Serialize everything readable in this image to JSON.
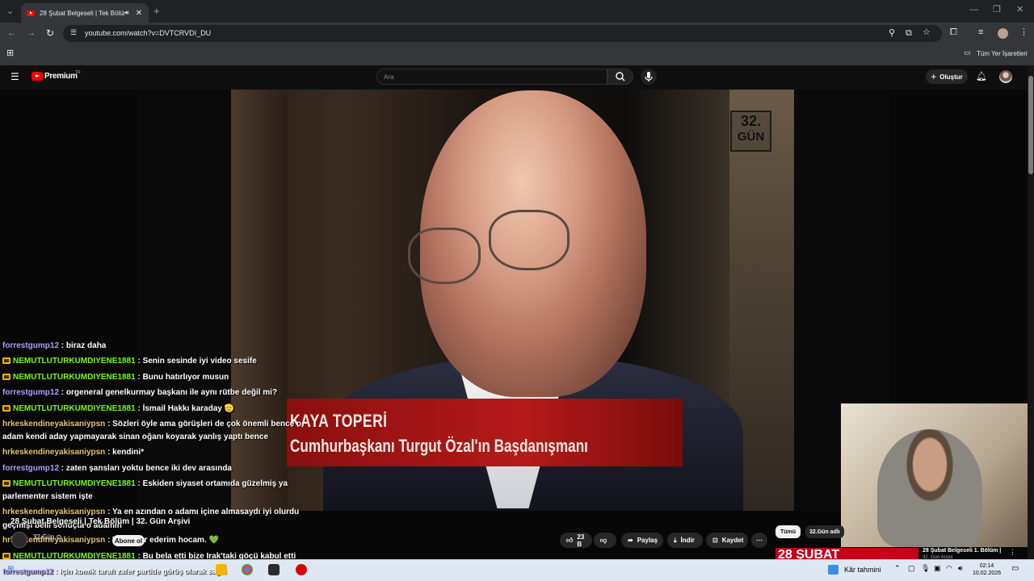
{
  "browser": {
    "tab_title": "28 Şubat Belgeseli | Tek Bölüm",
    "url": "youtube.com/watch?v=DVTCRVDI_DU",
    "bookmarks_label": "Tüm Yer İşaretleri"
  },
  "yt_header": {
    "logo_text": "Premium",
    "logo_region": "TR",
    "search_placeholder": "Ara",
    "create_label": "Oluştur"
  },
  "video": {
    "channel_logo_line1": "32.",
    "channel_logo_line2": "GÜN",
    "lower_third_name": "KAYA TOPERİ",
    "lower_third_title": "Cumhurbaşkanı Turgut Özal'ın Başdanışmanı",
    "title": "28 Şubat Belgeseli | Tek Bölüm | 32. Gün Arşivi",
    "channel": "32.Gün ⊙",
    "subscribe_label": "Abone ol"
  },
  "chat": [
    {
      "user": "forrestgump12",
      "color": "purple",
      "badge": false,
      "text": ": biraz daha"
    },
    {
      "user": "NEMUTLUTURKUMDIYENE1881",
      "color": "green",
      "badge": true,
      "text": ": Senin sesinde iyi video sesife"
    },
    {
      "user": "NEMUTLUTURKUMDIYENE1881",
      "color": "green",
      "badge": true,
      "text": ": Bunu hatırlıyor musun"
    },
    {
      "user": "forrestgump12",
      "color": "purple",
      "badge": false,
      "text": ": orgeneral genelkurmay başkanı ile aynı rütbe değil mi?"
    },
    {
      "user": "NEMUTLUTURKUMDIYENE1881",
      "color": "green",
      "badge": true,
      "text": ": İsmail Hakkı karaday 🫡"
    },
    {
      "user": "hrkeskendineyakisaniypsn",
      "color": "gold",
      "badge": false,
      "text": ": Sözleri öyle ama görüşleri de çok önemli bence o"
    },
    {
      "user": "",
      "color": "",
      "badge": false,
      "text": "adam kendi aday yapmayarak sinan oğanı koyarak yanlış yaptı bence"
    },
    {
      "user": "hrkeskendineyakisaniypsn",
      "color": "gold",
      "badge": false,
      "text": ": kendini*"
    },
    {
      "user": "forrestgump12",
      "color": "purple",
      "badge": false,
      "text": ": zaten şansları yoktu bence iki dev arasında"
    },
    {
      "user": "NEMUTLUTURKUMDIYENE1881",
      "color": "green",
      "badge": true,
      "text": ": Eskiden siyaset ortamıda güzelmiş ya"
    },
    {
      "user": "",
      "color": "",
      "badge": false,
      "text": "parlementer sistem işte"
    },
    {
      "user": "hrkeskendineyakisaniypsn",
      "color": "gold",
      "badge": false,
      "text": ": Ya en azından o adamı içine almasaydı iyi olurdu"
    },
    {
      "user": "",
      "color": "",
      "badge": false,
      "text": "geçmişi belli sonuçta o adamın"
    },
    {
      "user": "hrkeskendineyakisaniypsn",
      "color": "gold",
      "badge": false,
      "text": ": Teşekkür ederim hocam. 💚"
    },
    {
      "user": "NEMUTLUTURKUMDIYENE1881",
      "color": "green",
      "badge": true,
      "text": ": Bu bela etti bize Irak'taki göçü kabul etti"
    },
    {
      "user": "forrestgump12",
      "color": "purple",
      "badge": false,
      "text": ": için komik tarafı zafer partide görüş olarak sağcı"
    }
  ],
  "actions": {
    "like_count": "23 B",
    "share_label": "Paylaş",
    "download_label": "İndir",
    "save_label": "Kaydet"
  },
  "related": {
    "chip_all": "Tümü",
    "chip_channel": "32.Gün adlı",
    "thumb_text": "28 ŞUBAT",
    "rec_title": "28 Şubat Belgeseli 1. Bölüm |",
    "rec_sub": "32. Gün Arşivi"
  },
  "taskbar": {
    "weather": "Kâr tahmini",
    "time": "02:14",
    "date": "10.02.2026"
  }
}
